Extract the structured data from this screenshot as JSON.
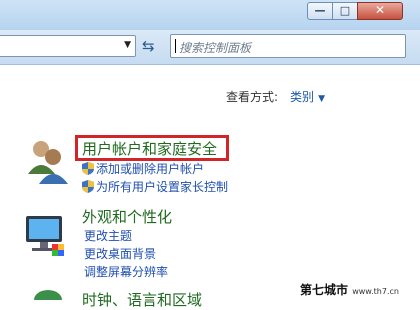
{
  "window": {
    "minimize_glyph": "—",
    "maximize_glyph": "□",
    "close_glyph": "✕"
  },
  "toolbar": {
    "search_placeholder": "搜索控制面板"
  },
  "view": {
    "label": "查看方式:",
    "value": "类别"
  },
  "categories": [
    {
      "title": "用户帐户和家庭安全",
      "links": [
        "添加或删除用户帐户",
        "为所有用户设置家长控制"
      ]
    },
    {
      "title": "外观和个性化",
      "links": [
        "更改主题",
        "更改桌面背景",
        "调整屏幕分辨率"
      ]
    },
    {
      "title": "时钟、语言和区域",
      "links": []
    }
  ],
  "watermark": {
    "text": "第七城市",
    "url": "www.th7.cn"
  }
}
